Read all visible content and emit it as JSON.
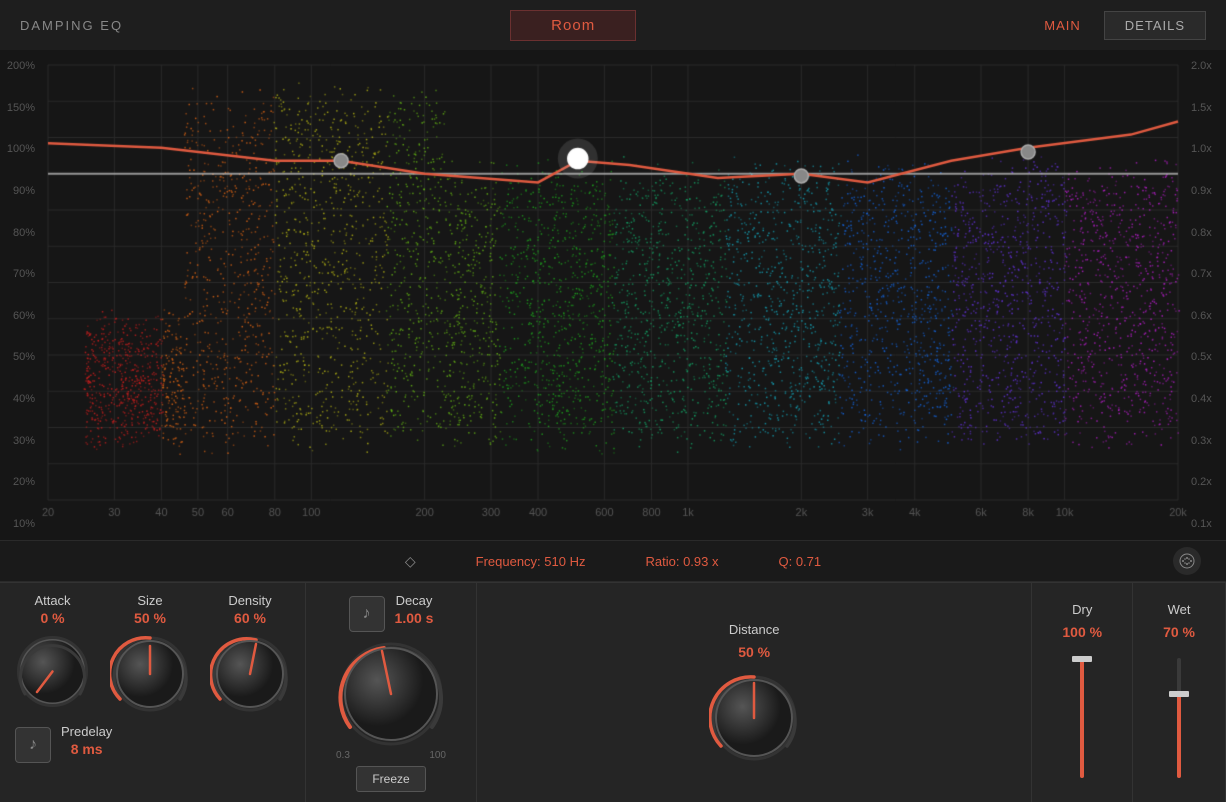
{
  "header": {
    "title": "DAMPING EQ",
    "preset": "Room",
    "tabs": [
      {
        "label": "MAIN",
        "active": true
      },
      {
        "label": "DETAILS",
        "active": false
      }
    ]
  },
  "eq": {
    "y_labels_left": [
      "200%",
      "150%",
      "100%",
      "90%",
      "80%",
      "70%",
      "60%",
      "50%",
      "40%",
      "30%",
      "20%",
      "10%"
    ],
    "y_labels_right": [
      "2.0x",
      "1.5x",
      "1.0x",
      "0.9x",
      "0.8x",
      "0.7x",
      "0.6x",
      "0.5x",
      "0.4x",
      "0.3x",
      "0.2x",
      "0.1x"
    ],
    "x_labels": [
      "20",
      "30",
      "40",
      "50",
      "60",
      "80",
      "100",
      "200",
      "300",
      "400",
      "600",
      "800",
      "1k",
      "2k",
      "3k",
      "4k",
      "6k",
      "8k",
      "10k",
      "20k"
    ]
  },
  "info_bar": {
    "diamond_icon": "◇",
    "frequency_label": "Frequency:",
    "frequency_value": "510 Hz",
    "ratio_label": "Ratio:",
    "ratio_value": "0.93 x",
    "q_label": "Q:",
    "q_value": "0.71"
  },
  "controls": {
    "attack": {
      "label": "Attack",
      "value": "0 %",
      "rotation": -135
    },
    "size": {
      "label": "Size",
      "value": "50 %",
      "rotation": 0
    },
    "density": {
      "label": "Density",
      "value": "60 %",
      "rotation": 30
    },
    "decay": {
      "label": "Decay",
      "value": "1.00 s",
      "min": "0.3",
      "max": "100",
      "rotation": -20
    },
    "distance": {
      "label": "Distance",
      "value": "50 %",
      "rotation": 0
    },
    "dry": {
      "label": "Dry",
      "value": "100 %",
      "fill_pct": 100
    },
    "wet": {
      "label": "Wet",
      "value": "70 %",
      "fill_pct": 70
    },
    "predelay": {
      "label": "Predelay",
      "value": "8 ms"
    },
    "freeze_btn": "Freeze",
    "note_icon": "♪"
  }
}
